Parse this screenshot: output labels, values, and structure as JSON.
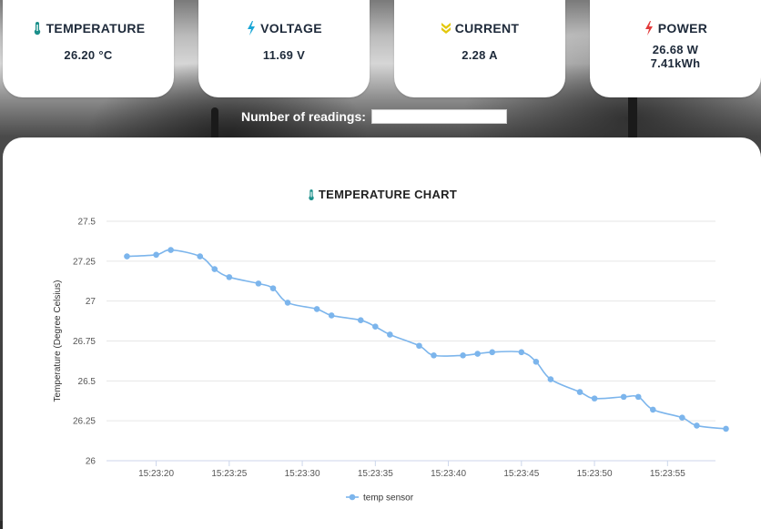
{
  "cards": [
    {
      "title": "TEMPERATURE",
      "icon": "thermometer-icon",
      "icon_color": "#1a8f8a",
      "value": "26.20 °C"
    },
    {
      "title": "VOLTAGE",
      "icon": "bolt-icon",
      "icon_color": "#1aa6d6",
      "value": "11.69 V"
    },
    {
      "title": "CURRENT",
      "icon": "double-chevron-down-icon",
      "icon_color": "#e3c80d",
      "value": "2.28 A"
    },
    {
      "title": "POWER",
      "icon": "bolt-icon",
      "icon_color": "#e23a3a",
      "value": "26.68 W",
      "value2": "7.41kWh"
    }
  ],
  "readings": {
    "label": "Number of readings:",
    "value": ""
  },
  "chart": {
    "title": "TEMPERATURE CHART",
    "icon": "thermometer-icon",
    "icon_color": "#1a8f8a"
  },
  "chart_data": {
    "type": "line",
    "title": "TEMPERATURE CHART",
    "xlabel": "",
    "ylabel": "Temperature (Degree Celsius)",
    "ylim": [
      26,
      27.5
    ],
    "yticks": [
      "26",
      "26.25",
      "26.5",
      "26.75",
      "27",
      "27.25",
      "27.5"
    ],
    "xticks": [
      "15:23:20",
      "15:23:25",
      "15:23:30",
      "15:23:35",
      "15:23:40",
      "15:23:45",
      "15:23:50",
      "15:23:55"
    ],
    "series": [
      {
        "name": "temp sensor",
        "color": "#7cb5ec",
        "points": [
          [
            "15:23:18",
            27.28
          ],
          [
            "15:23:20",
            27.29
          ],
          [
            "15:23:21",
            27.32
          ],
          [
            "15:23:23",
            27.28
          ],
          [
            "15:23:24",
            27.2
          ],
          [
            "15:23:25",
            27.15
          ],
          [
            "15:23:27",
            27.11
          ],
          [
            "15:23:28",
            27.08
          ],
          [
            "15:23:29",
            26.99
          ],
          [
            "15:23:31",
            26.95
          ],
          [
            "15:23:32",
            26.91
          ],
          [
            "15:23:34",
            26.88
          ],
          [
            "15:23:35",
            26.84
          ],
          [
            "15:23:36",
            26.79
          ],
          [
            "15:23:38",
            26.72
          ],
          [
            "15:23:39",
            26.66
          ],
          [
            "15:23:41",
            26.66
          ],
          [
            "15:23:42",
            26.67
          ],
          [
            "15:23:43",
            26.68
          ],
          [
            "15:23:45",
            26.68
          ],
          [
            "15:23:46",
            26.62
          ],
          [
            "15:23:47",
            26.51
          ],
          [
            "15:23:49",
            26.43
          ],
          [
            "15:23:50",
            26.39
          ],
          [
            "15:23:52",
            26.4
          ],
          [
            "15:23:53",
            26.4
          ],
          [
            "15:23:54",
            26.32
          ],
          [
            "15:23:56",
            26.27
          ],
          [
            "15:23:57",
            26.22
          ],
          [
            "15:23:59",
            26.2
          ]
        ]
      }
    ],
    "grid": true,
    "legend": "bottom-center"
  }
}
